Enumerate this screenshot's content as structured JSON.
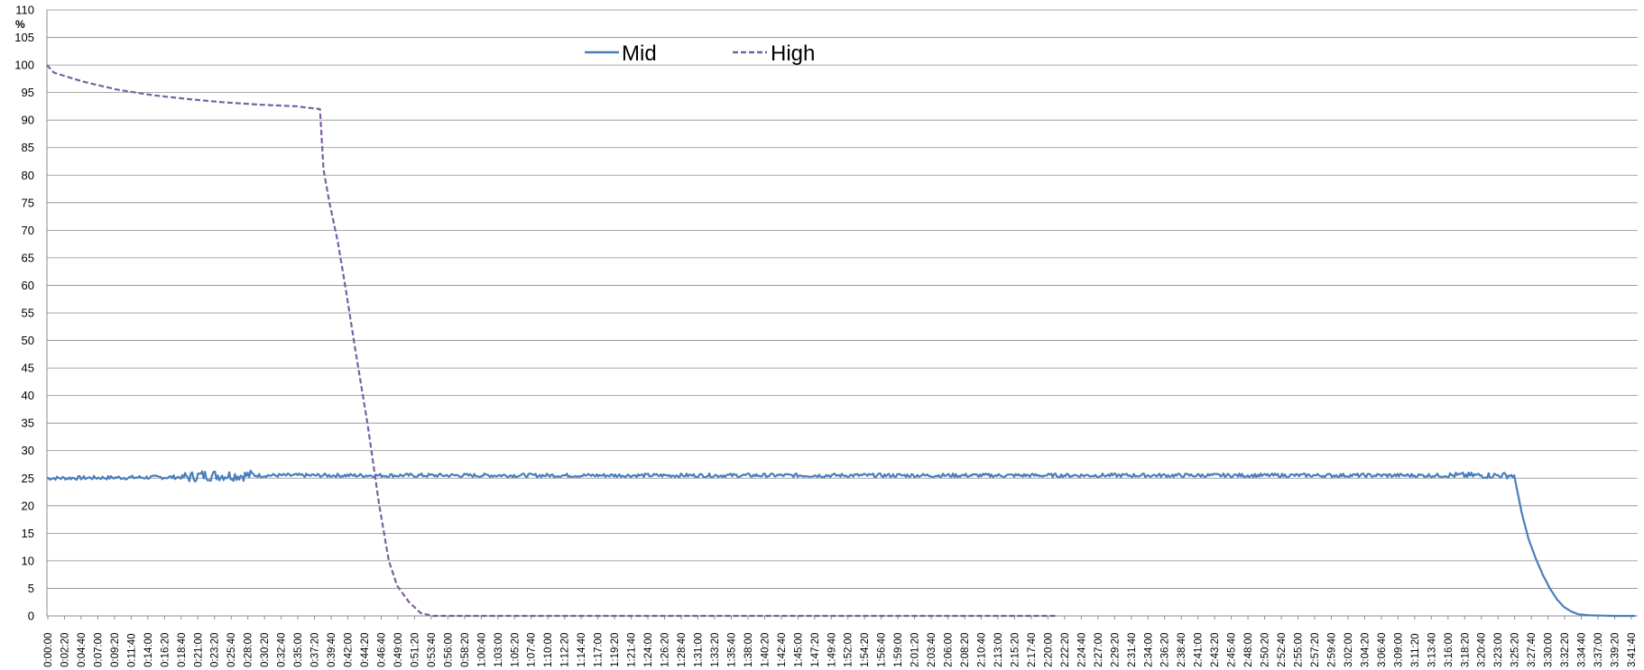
{
  "chart_data": {
    "type": "line",
    "title": "",
    "xlabel": "",
    "ylabel": "%",
    "ylim": [
      0,
      110
    ],
    "ytick_step": 5,
    "grid": true,
    "legend_position": "top-left",
    "x_tick_labels": [
      "0:00:00",
      "0:02:20",
      "0:04:40",
      "0:07:00",
      "0:09:20",
      "0:11:40",
      "0:14:00",
      "0:16:20",
      "0:18:40",
      "0:21:00",
      "0:23:20",
      "0:25:40",
      "0:28:00",
      "0:30:20",
      "0:32:40",
      "0:35:00",
      "0:37:20",
      "0:39:40",
      "0:42:00",
      "0:44:20",
      "0:46:40",
      "0:49:00",
      "0:51:20",
      "0:53:40",
      "0:56:00",
      "0:58:20",
      "1:00:40",
      "1:03:00",
      "1:05:20",
      "1:07:40",
      "1:10:00",
      "1:12:20",
      "1:14:40",
      "1:17:00",
      "1:19:20",
      "1:21:40",
      "1:24:00",
      "1:26:20",
      "1:28:40",
      "1:31:00",
      "1:33:20",
      "1:35:40",
      "1:38:00",
      "1:40:20",
      "1:42:40",
      "1:45:00",
      "1:47:20",
      "1:49:40",
      "1:52:00",
      "1:54:20",
      "1:56:40",
      "1:59:00",
      "2:01:20",
      "2:03:40",
      "2:06:00",
      "2:08:20",
      "2:10:40",
      "2:13:00",
      "2:15:20",
      "2:17:40",
      "2:20:00",
      "2:22:20",
      "2:24:40",
      "2:27:00",
      "2:29:20",
      "2:31:40",
      "2:34:00",
      "2:36:20",
      "2:38:40",
      "2:41:00",
      "2:43:20",
      "2:45:40",
      "2:48:00",
      "2:50:20",
      "2:52:40",
      "2:55:00",
      "2:57:20",
      "2:59:40",
      "3:02:00",
      "3:04:20",
      "3:06:40",
      "3:09:00",
      "3:11:20",
      "3:13:40",
      "3:16:00",
      "3:18:20",
      "3:20:40",
      "3:23:00",
      "3:25:20",
      "3:27:40",
      "3:30:00",
      "3:32:20",
      "3:34:40",
      "3:37:00",
      "3:39:20",
      "3:41:40"
    ],
    "x_range_seconds": [
      0,
      13400
    ],
    "series": [
      {
        "name": "Mid",
        "color": "#4a7ebb",
        "dash": "solid",
        "x_seconds": [
          0,
          1200,
          1300,
          1800,
          2400,
          3000,
          6000,
          9000,
          12000,
          12300,
          12360,
          12420,
          12480,
          12540,
          12600,
          12660,
          12720,
          12780,
          12840,
          12900,
          13000,
          13100,
          13200,
          13380
        ],
        "y": [
          25,
          25.2,
          25.5,
          25.5,
          25.5,
          25.5,
          25.5,
          25.5,
          25.5,
          25.5,
          25.5,
          19,
          14,
          10.5,
          7.5,
          5,
          3,
          1.6,
          0.8,
          0.3,
          0.1,
          0.05,
          0,
          0
        ]
      },
      {
        "name": "High",
        "color": "#7b5fa5",
        "dash": "dashed",
        "x_seconds": [
          0,
          60,
          300,
          600,
          900,
          1200,
          1500,
          1800,
          2100,
          2300,
          2330,
          2380,
          2450,
          2520,
          2600,
          2700,
          2800,
          2880,
          2950,
          3050,
          3150,
          3250,
          3400,
          3800,
          8500
        ],
        "y": [
          100,
          98.6,
          97,
          95.5,
          94.5,
          93.8,
          93.2,
          92.8,
          92.5,
          92,
          81,
          75,
          68,
          59,
          48,
          35,
          20,
          10,
          5.5,
          2.5,
          0.5,
          0,
          0,
          0,
          0
        ]
      }
    ]
  }
}
